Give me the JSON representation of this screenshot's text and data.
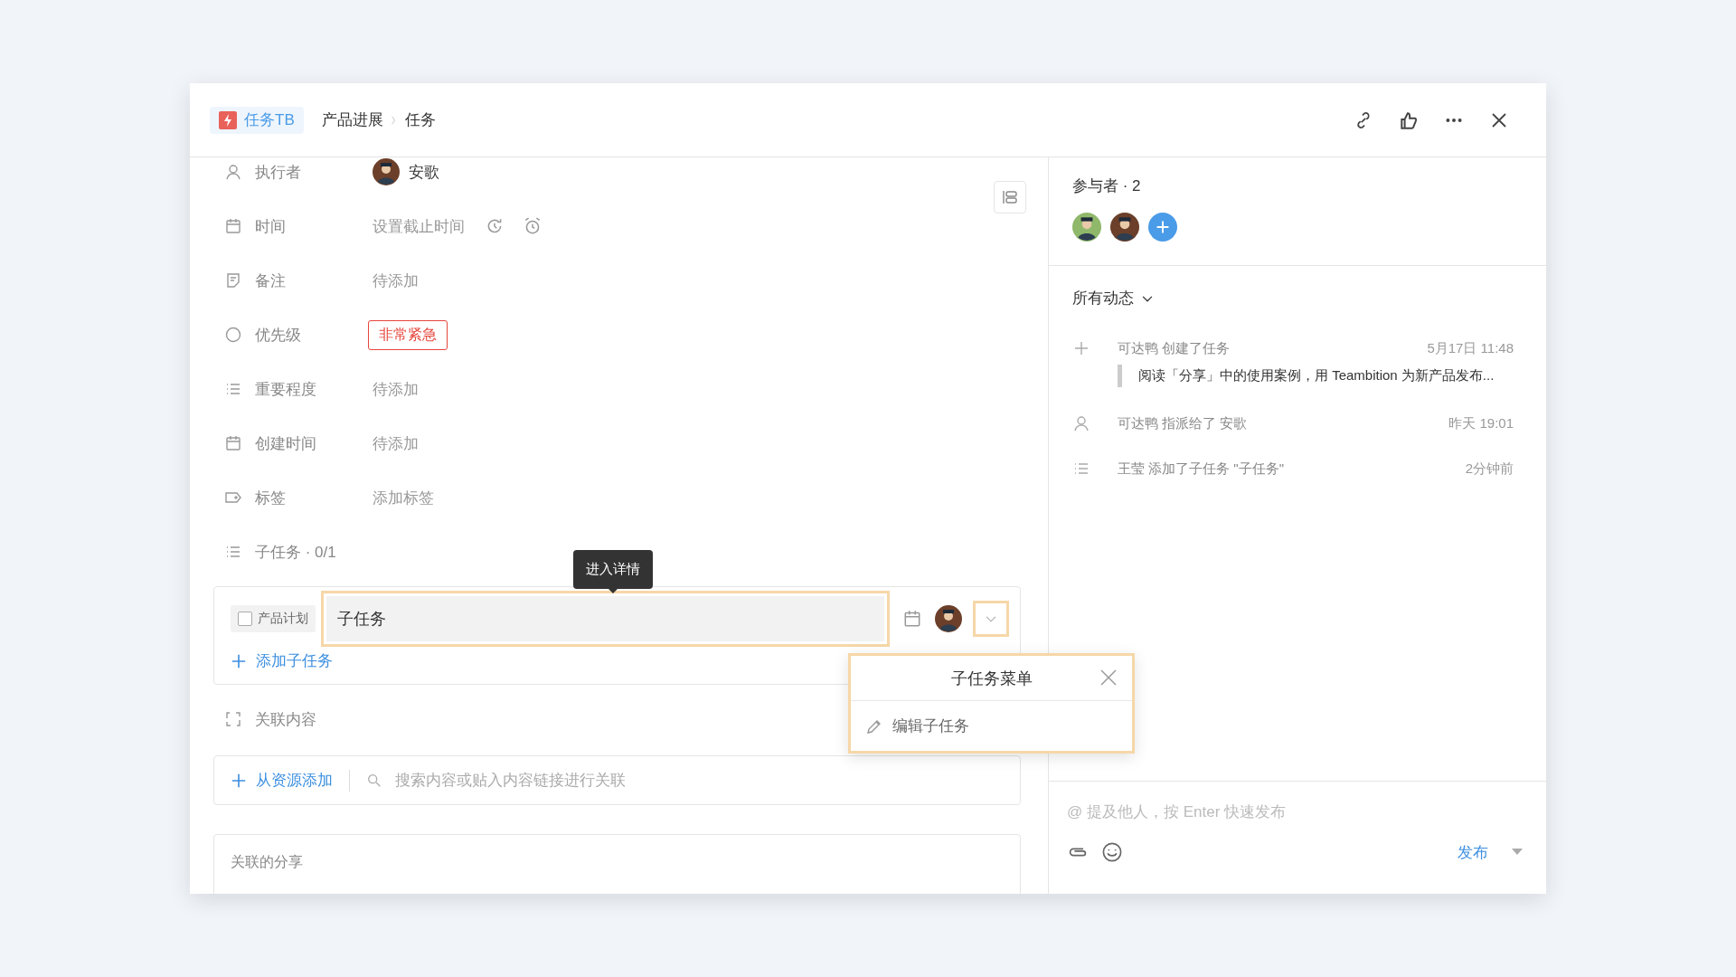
{
  "header": {
    "app_badge": "任务TB",
    "breadcrumb": [
      "产品进展",
      "任务"
    ]
  },
  "fields": [
    {
      "kind": "assignee",
      "label": "执行者",
      "value": "安歌"
    },
    {
      "kind": "time",
      "label": "时间",
      "placeholder": "设置截止时间"
    },
    {
      "kind": "note",
      "label": "备注",
      "placeholder": "待添加"
    },
    {
      "kind": "priority",
      "label": "优先级",
      "value": "非常紧急"
    },
    {
      "kind": "importance",
      "label": "重要程度",
      "placeholder": "待添加"
    },
    {
      "kind": "created",
      "label": "创建时间",
      "placeholder": "待添加"
    },
    {
      "kind": "tag",
      "label": "标签",
      "placeholder": "添加标签"
    }
  ],
  "subtasks": {
    "title": "子任务 · 0/1",
    "items": [
      {
        "project": "产品计划",
        "title": "子任务",
        "checked": false
      }
    ],
    "add": "添加子任务",
    "tooltip": "进入详情",
    "menu": {
      "title": "子任务菜单",
      "items": [
        "编辑子任务"
      ]
    }
  },
  "related": {
    "title": "关联内容",
    "add": "从资源添加",
    "search_placeholder": "搜索内容或贴入内容链接进行关联",
    "shares_title": "关联的分享"
  },
  "participants": {
    "title": "参与者 · 2"
  },
  "activity": {
    "filter": "所有动态",
    "items": [
      {
        "kind": "create",
        "text": "可达鸭 创建了任务",
        "time": "5月17日 11:48",
        "quote": "阅读「分享」中的使用案例，用 Teambition 为新产品发布..."
      },
      {
        "kind": "assign",
        "text": "可达鸭 指派给了 安歌",
        "time": "昨天 19:01"
      },
      {
        "kind": "subtask",
        "text": "王莹 添加了子任务 \"子任务\"",
        "time": "2分钟前"
      }
    ]
  },
  "comment": {
    "placeholder": "@ 提及他人，按 Enter 快速发布",
    "submit": "发布"
  }
}
